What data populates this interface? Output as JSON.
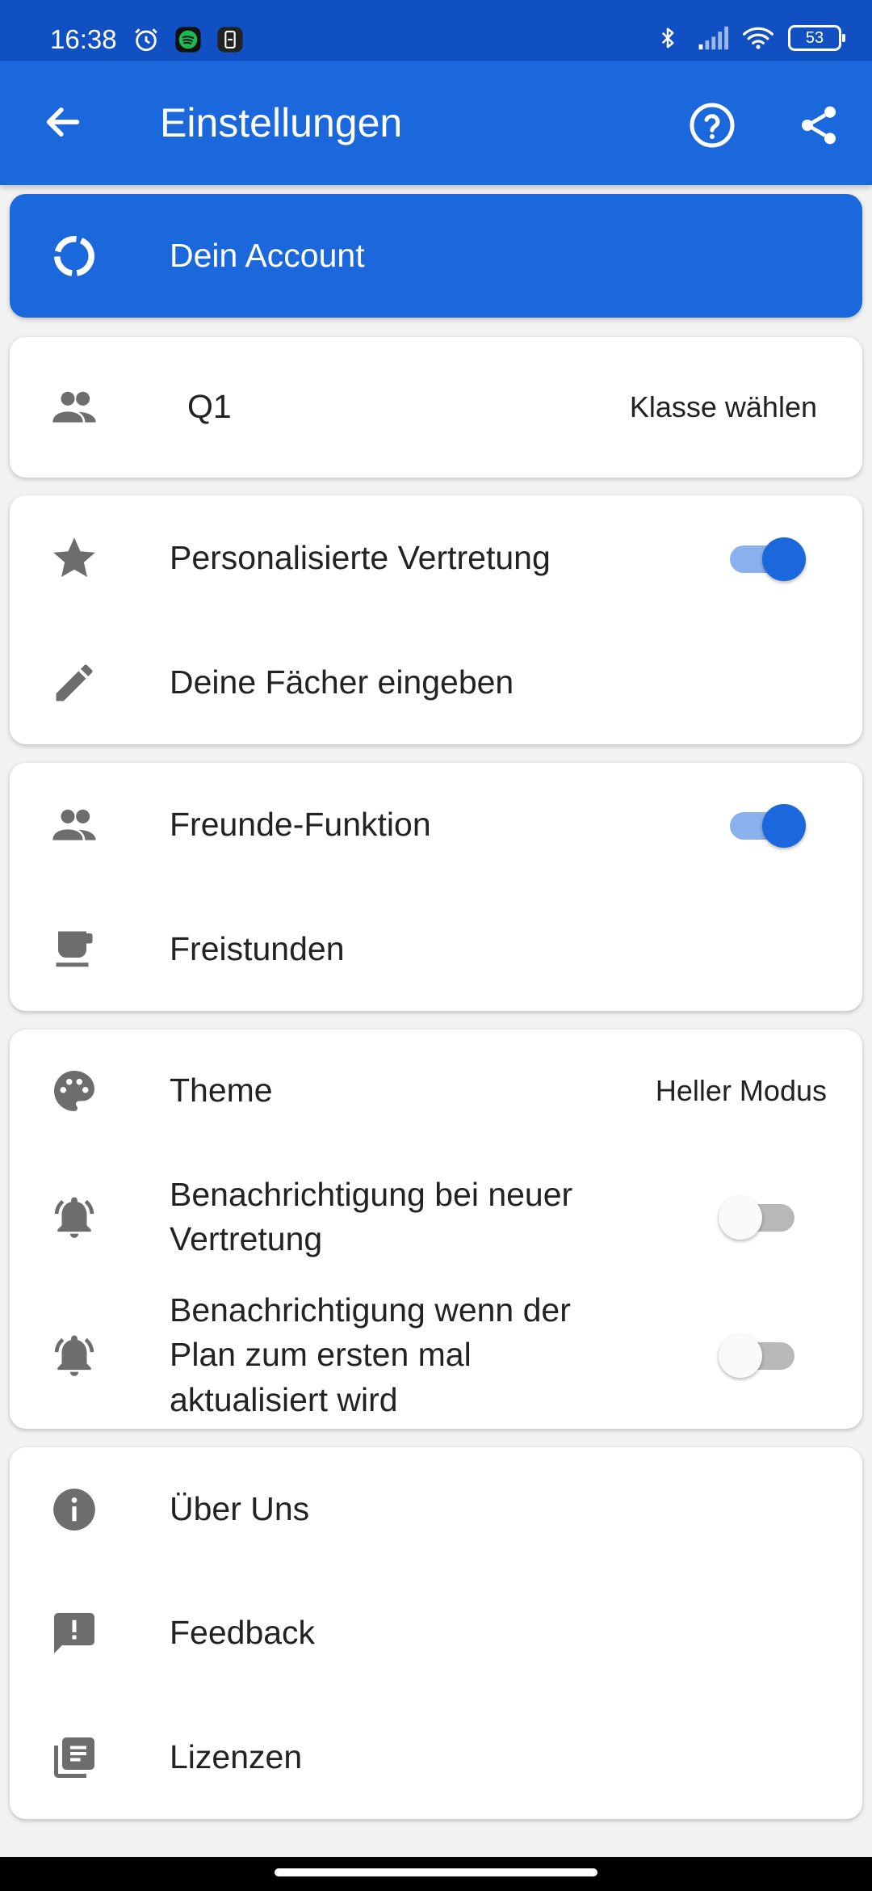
{
  "status_bar": {
    "time": "16:38",
    "battery": "53"
  },
  "app_bar": {
    "title": "Einstellungen"
  },
  "account": {
    "label": "Dein Account"
  },
  "class_card": {
    "class_name": "Q1",
    "action": "Klasse wählen"
  },
  "personal_card": {
    "personalized_label": "Personalisierte Vertretung",
    "personalized_on": true,
    "subjects_label": "Deine Fächer eingeben"
  },
  "friends_card": {
    "friends_label": "Freunde-Funktion",
    "friends_on": true,
    "free_periods_label": "Freistunden"
  },
  "settings_card": {
    "theme_label": "Theme",
    "theme_value": "Heller Modus",
    "notify_new_line1": "Benachrichtigung bei neuer",
    "notify_new_line2": "Vertretung",
    "notify_new_on": false,
    "notify_plan_line1": "Benachrichtigung wenn der",
    "notify_plan_line2": "Plan zum ersten mal",
    "notify_plan_line3": "aktualisiert wird",
    "notify_plan_on": false
  },
  "info_card": {
    "about_label": "Über Uns",
    "feedback_label": "Feedback",
    "licenses_label": "Lizenzen"
  },
  "colors": {
    "primary": "#1b68dc",
    "status_bar": "#1150c2",
    "icon_grey": "#6d6d6d"
  }
}
